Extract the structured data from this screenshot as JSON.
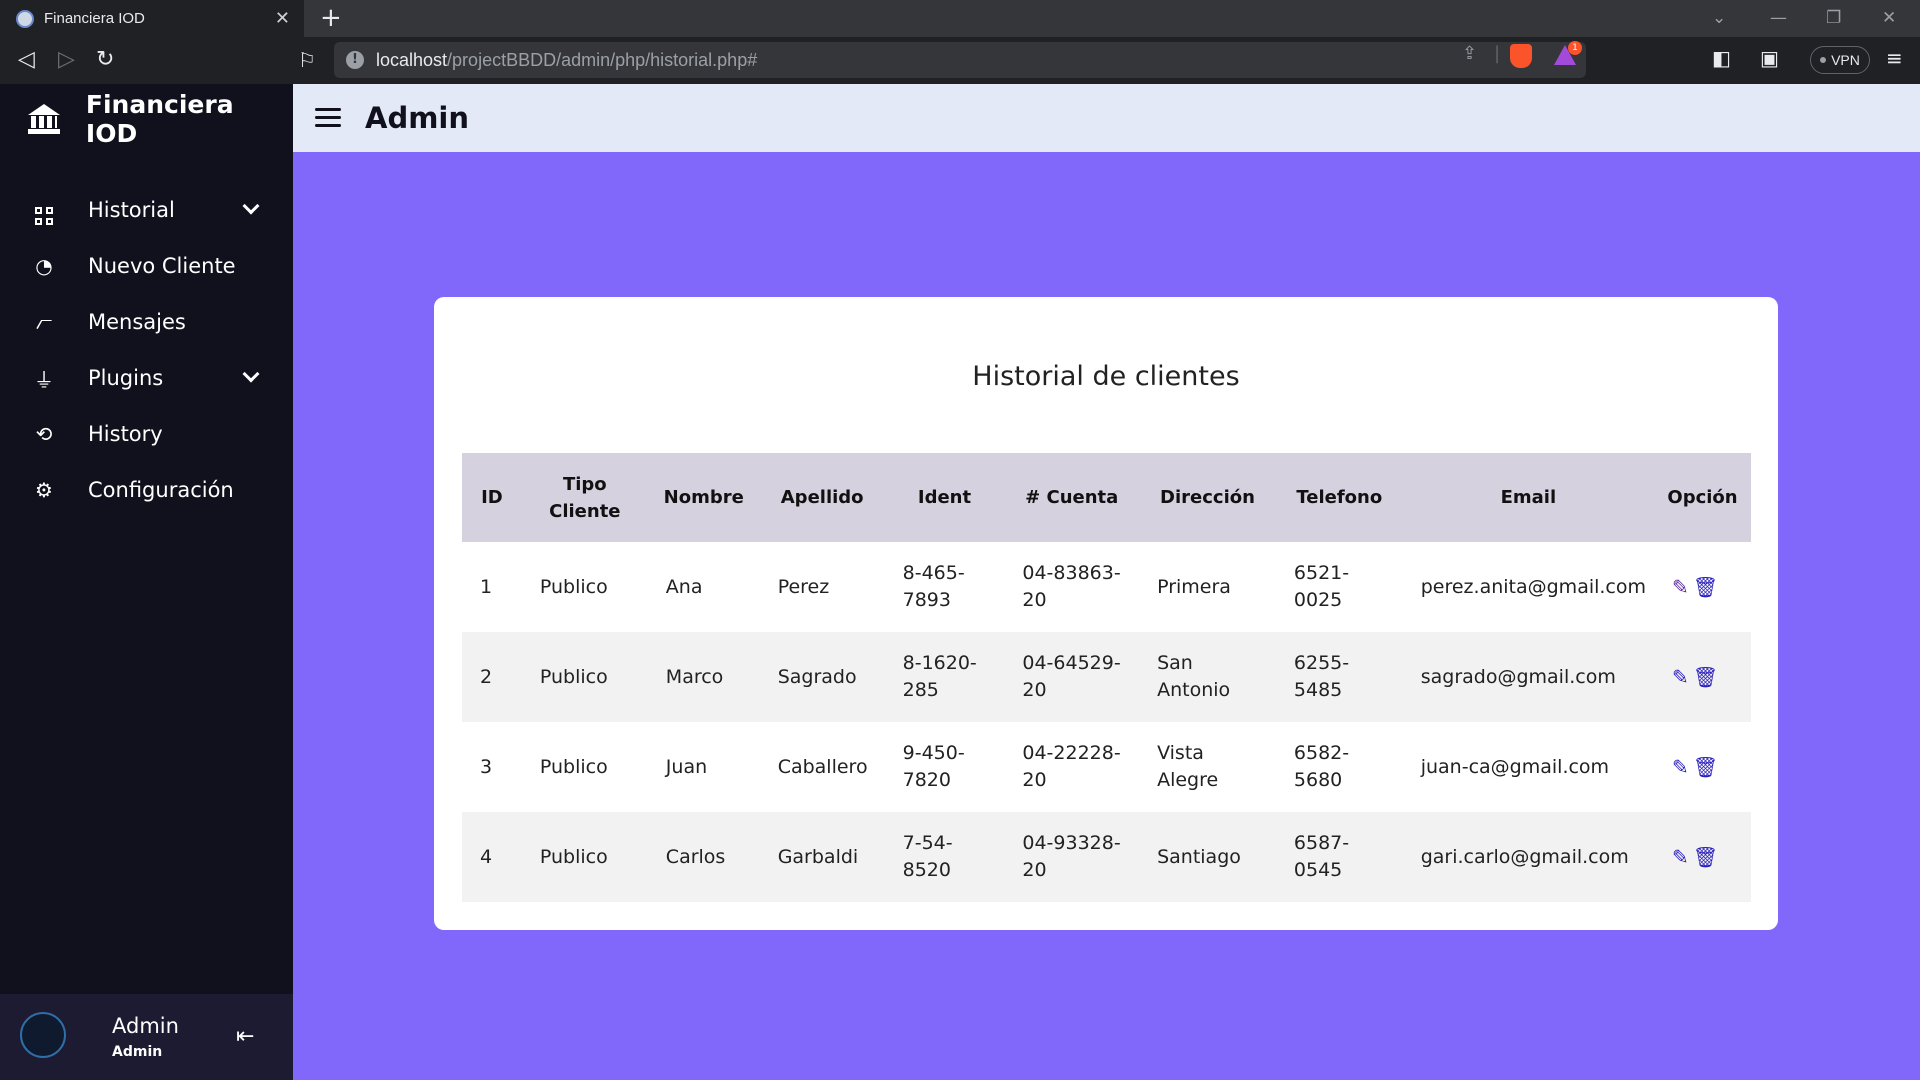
{
  "browser": {
    "tab_title": "Financiera IOD",
    "url_host": "localhost",
    "url_path": "/projectBBDD/admin/php/historial.php#",
    "vpn_label": "VPN",
    "rewards_badge": "1"
  },
  "sidebar": {
    "brand": "Financiera IOD",
    "items": [
      {
        "label": "Historial",
        "icon": "grid-icon",
        "has_submenu": true
      },
      {
        "label": "Nuevo Cliente",
        "icon": "pie-chart-icon",
        "has_submenu": false
      },
      {
        "label": "Mensajes",
        "icon": "line-chart-icon",
        "has_submenu": false
      },
      {
        "label": "Plugins",
        "icon": "plug-icon",
        "has_submenu": true
      },
      {
        "label": "History",
        "icon": "history-icon",
        "has_submenu": false
      },
      {
        "label": "Configuración",
        "icon": "gear-icon",
        "has_submenu": false
      }
    ],
    "profile": {
      "name": "Admin",
      "role": "Admin"
    }
  },
  "header": {
    "title": "Admin"
  },
  "table": {
    "title": "Historial de clientes",
    "columns": [
      "ID",
      "Tipo Cliente",
      "Nombre",
      "Apellido",
      "Ident",
      "# Cuenta",
      "Dirección",
      "Telefono",
      "Email",
      "Opción"
    ],
    "rows": [
      {
        "id": "1",
        "tipo": "Publico",
        "nombre": "Ana",
        "apellido": "Perez",
        "ident": "8-465-7893",
        "cuenta": "04-83863-20",
        "direccion": "Primera",
        "telefono": "6521-0025",
        "email": "perez.anita@gmail.com"
      },
      {
        "id": "2",
        "tipo": "Publico",
        "nombre": "Marco",
        "apellido": "Sagrado",
        "ident": "8-1620-285",
        "cuenta": "04-64529-20",
        "direccion": "San Antonio",
        "telefono": "6255-5485",
        "email": "sagrado@gmail.com"
      },
      {
        "id": "3",
        "tipo": "Publico",
        "nombre": "Juan",
        "apellido": "Caballero",
        "ident": "9-450-7820",
        "cuenta": "04-22228-20",
        "direccion": "Vista Alegre",
        "telefono": "6582-5680",
        "email": "juan-ca@gmail.com"
      },
      {
        "id": "4",
        "tipo": "Publico",
        "nombre": "Carlos",
        "apellido": "Garbaldi",
        "ident": "7-54-8520",
        "cuenta": "04-93328-20",
        "direccion": "Santiago",
        "telefono": "6587-0545",
        "email": "gari.carlo@gmail.com"
      }
    ]
  },
  "colors": {
    "sidebar": "#11101d",
    "content": "#8167fa",
    "header": "#e4e9f7",
    "table_header": "#d5d1de",
    "action_icon": "#2a1fbf"
  }
}
